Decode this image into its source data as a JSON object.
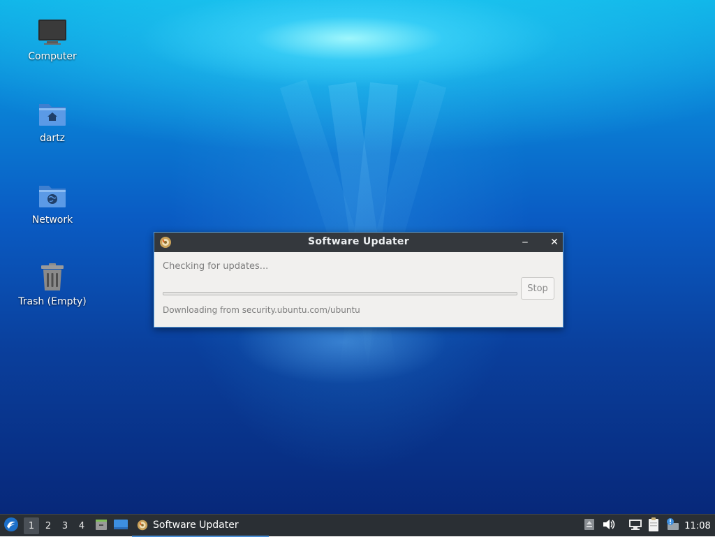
{
  "desktop": {
    "icons": [
      {
        "label": "Computer",
        "icon": "computer-icon"
      },
      {
        "label": "dartz",
        "icon": "home-folder-icon"
      },
      {
        "label": "Network",
        "icon": "network-folder-icon"
      },
      {
        "label": "Trash (Empty)",
        "icon": "trash-icon"
      }
    ]
  },
  "dialog": {
    "title": "Software Updater",
    "app_icon": "software-updater-icon",
    "minimize_symbol": "‒",
    "close_symbol": "✕",
    "status": "Checking for updates...",
    "progress": 0,
    "stop_label": "Stop",
    "detail": "Downloading from security.ubuntu.com/ubuntu"
  },
  "taskbar": {
    "menu_icon": "lubuntu-menu-icon",
    "workspaces": [
      "1",
      "2",
      "3",
      "4"
    ],
    "active_workspace": "1",
    "launchers": [
      "file-manager-icon",
      "show-desktop-icon"
    ],
    "tasks": [
      {
        "label": "Software Updater",
        "icon": "software-updater-icon"
      }
    ],
    "tray": [
      "eject-icon",
      "volume-icon",
      "network-icon",
      "clipboard-icon",
      "update-notifier-icon"
    ],
    "clock": "11:08"
  },
  "colors": {
    "accent": "#4a90d9",
    "titlebar": "#34383d",
    "taskbar": "#2a2f34"
  }
}
